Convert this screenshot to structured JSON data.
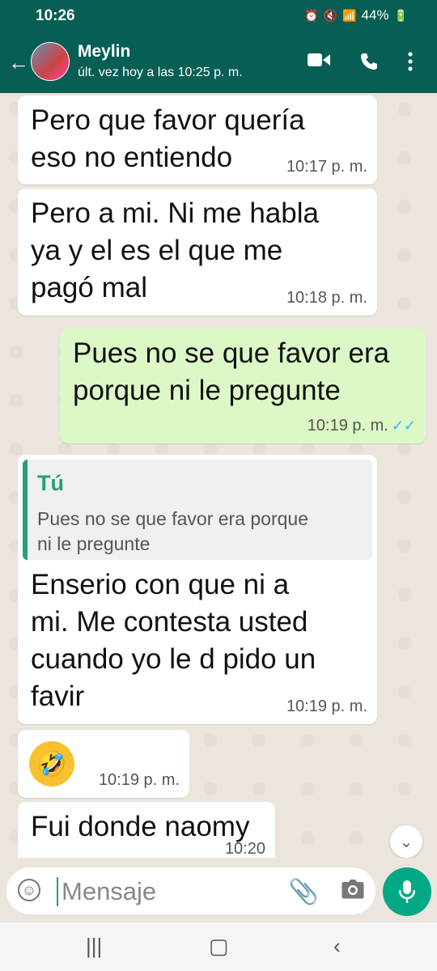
{
  "status_bar": {
    "time": "10:26",
    "battery": "44%"
  },
  "header": {
    "contact_name": "Meylin",
    "last_seen": "últ. vez hoy a las 10:25 p. m."
  },
  "messages": [
    {
      "direction": "in",
      "text": "Pero que favor quería\neso no entiendo",
      "time": "10:17 p. m."
    },
    {
      "direction": "in",
      "text": "Pero a mi. Ni me habla\nya y el es el que me\npagó mal",
      "time": "10:18 p. m."
    },
    {
      "direction": "out",
      "text": "Pues no se que favor era\nporque ni le pregunte",
      "time": "10:19 p. m.",
      "read": true
    },
    {
      "direction": "in",
      "quote_author": "Tú",
      "quote_text": "Pues no se que favor era porque\nni le pregunte",
      "text": "Enserio con que ni a\nmi. Me contesta usted\ncuando yo le d pido un\nfavir",
      "time": "10:19 p. m."
    },
    {
      "direction": "in",
      "emoji": "rolling-on-floor-laughing",
      "time": "10:19 p. m."
    },
    {
      "direction": "in",
      "text": "Fui donde naomy",
      "time": "10:20"
    }
  ],
  "composer": {
    "placeholder": "Mensaje"
  },
  "colors": {
    "header": "#075e54",
    "outgoing": "#dcf8c6",
    "incoming": "#ffffff",
    "accent": "#00a884"
  }
}
